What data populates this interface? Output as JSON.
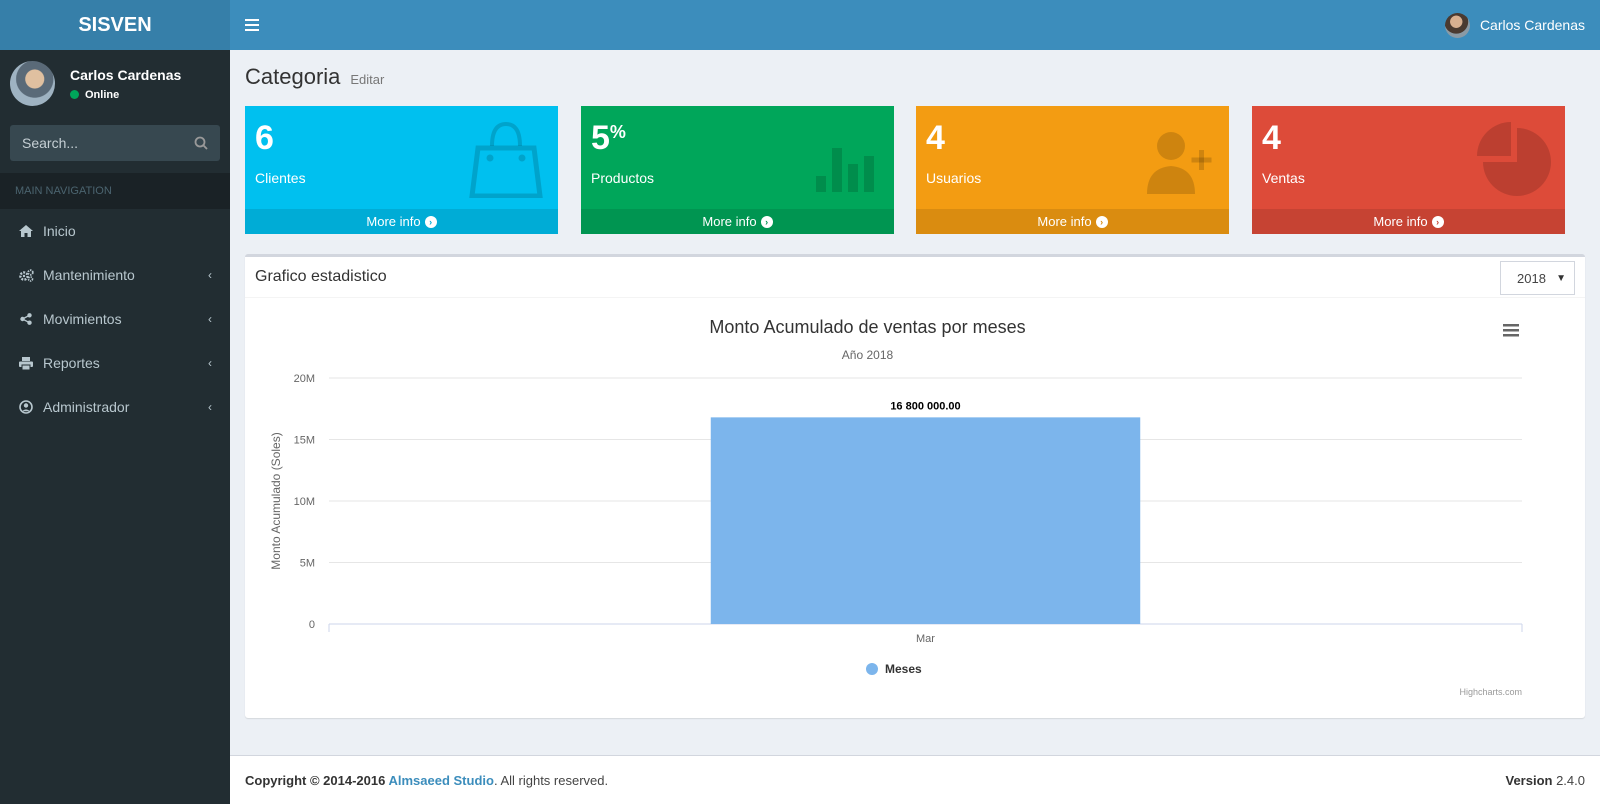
{
  "app": {
    "logo": "SISVEN"
  },
  "header": {
    "user_name": "Carlos Cardenas"
  },
  "sidebar": {
    "user_name": "Carlos Cardenas",
    "status": "Online",
    "search_placeholder": "Search...",
    "nav_header": "MAIN NAVIGATION",
    "items": [
      {
        "label": "Inicio",
        "icon": "home-icon"
      },
      {
        "label": "Mantenimiento",
        "icon": "cogs-icon"
      },
      {
        "label": "Movimientos",
        "icon": "share-icon"
      },
      {
        "label": "Reportes",
        "icon": "print-icon"
      },
      {
        "label": "Administrador",
        "icon": "user-circle-icon"
      }
    ]
  },
  "page": {
    "title": "Categoria",
    "subtitle": "Editar"
  },
  "boxes": [
    {
      "value": "6",
      "sup": "",
      "label": "Clientes",
      "footer": "More info",
      "color": "#00c0ef",
      "footer_color": "#00acd6",
      "icon": "shopping-bag-icon"
    },
    {
      "value": "5",
      "sup": "%",
      "label": "Productos",
      "footer": "More info",
      "color": "#00a65a",
      "footer_color": "#009551",
      "icon": "bar-chart-icon"
    },
    {
      "value": "4",
      "sup": "",
      "label": "Usuarios",
      "footer": "More info",
      "color": "#f39c12",
      "footer_color": "#da8c10",
      "icon": "user-plus-icon"
    },
    {
      "value": "4",
      "sup": "",
      "label": "Ventas",
      "footer": "More info",
      "color": "#dd4b39",
      "footer_color": "#c64333",
      "icon": "pie-chart-icon"
    }
  ],
  "chart_box": {
    "title": "Grafico estadistico",
    "year": "2018"
  },
  "chart_data": {
    "type": "bar",
    "title": "Monto Acumulado de ventas por meses",
    "subtitle": "Año 2018",
    "ylabel": "Monto Acumulado (Soles)",
    "categories": [
      "Mar"
    ],
    "series": [
      {
        "name": "Meses",
        "values": [
          16800000
        ],
        "color": "#7cb5ec"
      }
    ],
    "data_labels": [
      "16 800 000.00"
    ],
    "ylim": [
      0,
      20000000
    ],
    "yticks": [
      {
        "value": 0,
        "label": "0"
      },
      {
        "value": 5000000,
        "label": "5M"
      },
      {
        "value": 10000000,
        "label": "10M"
      },
      {
        "value": 15000000,
        "label": "15M"
      },
      {
        "value": 20000000,
        "label": "20M"
      }
    ],
    "grid": true,
    "legend": "bottom-center",
    "credits": "Highcharts.com"
  },
  "footer": {
    "copyright": "Copyright © 2014-2016 ",
    "company": "Almsaeed Studio",
    "rights": ". All rights reserved.",
    "version_label": "Version",
    "version": "2.4.0"
  }
}
